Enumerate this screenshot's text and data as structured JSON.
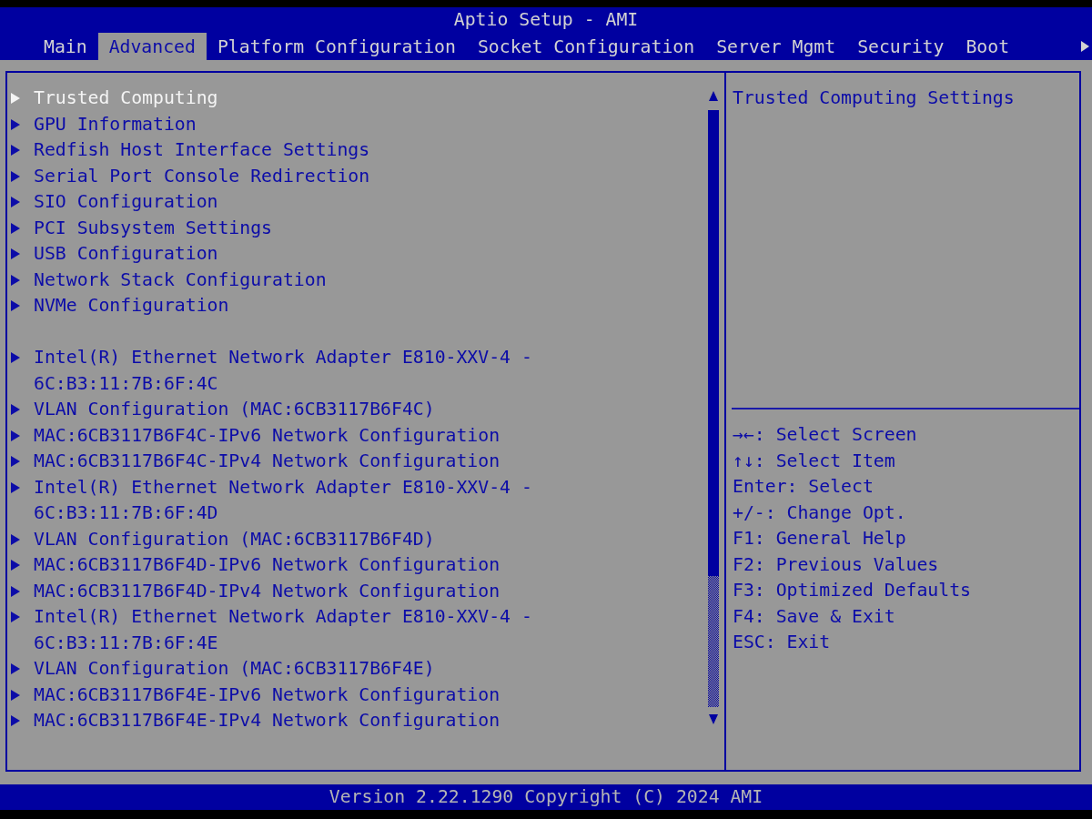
{
  "window": {
    "title": "Aptio Setup - AMI"
  },
  "tabs": [
    {
      "label": "Main",
      "selected": false
    },
    {
      "label": "Advanced",
      "selected": true
    },
    {
      "label": "Platform Configuration",
      "selected": false
    },
    {
      "label": "Socket Configuration",
      "selected": false
    },
    {
      "label": "Server Mgmt",
      "selected": false
    },
    {
      "label": "Security",
      "selected": false
    },
    {
      "label": "Boot",
      "selected": false
    }
  ],
  "menu": {
    "groups": [
      {
        "items": [
          {
            "label": "Trusted Computing",
            "selected": true
          },
          {
            "label": "GPU Information",
            "selected": false
          },
          {
            "label": "Redfish Host Interface Settings",
            "selected": false
          },
          {
            "label": "Serial Port Console Redirection",
            "selected": false
          },
          {
            "label": "SIO Configuration",
            "selected": false
          },
          {
            "label": "PCI Subsystem Settings",
            "selected": false
          },
          {
            "label": "USB Configuration",
            "selected": false
          },
          {
            "label": "Network Stack Configuration",
            "selected": false
          },
          {
            "label": "NVMe Configuration",
            "selected": false
          }
        ]
      },
      {
        "items": [
          {
            "label": "Intel(R) Ethernet Network Adapter E810-XXV-4 - 6C:B3:11:7B:6F:4C",
            "selected": false
          },
          {
            "label": "VLAN Configuration (MAC:6CB3117B6F4C)",
            "selected": false
          },
          {
            "label": "MAC:6CB3117B6F4C-IPv6 Network Configuration",
            "selected": false
          },
          {
            "label": "MAC:6CB3117B6F4C-IPv4 Network Configuration",
            "selected": false
          },
          {
            "label": "Intel(R) Ethernet Network Adapter E810-XXV-4 - 6C:B3:11:7B:6F:4D",
            "selected": false
          },
          {
            "label": "VLAN Configuration (MAC:6CB3117B6F4D)",
            "selected": false
          },
          {
            "label": "MAC:6CB3117B6F4D-IPv6 Network Configuration",
            "selected": false
          },
          {
            "label": "MAC:6CB3117B6F4D-IPv4 Network Configuration",
            "selected": false
          },
          {
            "label": "Intel(R) Ethernet Network Adapter E810-XXV-4 - 6C:B3:11:7B:6F:4E",
            "selected": false
          },
          {
            "label": "VLAN Configuration (MAC:6CB3117B6F4E)",
            "selected": false
          },
          {
            "label": "MAC:6CB3117B6F4E-IPv6 Network Configuration",
            "selected": false
          },
          {
            "label": "MAC:6CB3117B6F4E-IPv4 Network Configuration",
            "selected": false
          }
        ]
      }
    ]
  },
  "help": {
    "description": "Trusted Computing Settings",
    "keys": [
      "→←: Select Screen",
      "↑↓: Select Item",
      "Enter: Select",
      "+/-: Change Opt.",
      "F1: General Help",
      "F2: Previous Values",
      "F3: Optimized Defaults",
      "F4: Save & Exit",
      "ESC: Exit"
    ]
  },
  "status_bar": {
    "text": "Version 2.22.1290 Copyright (C) 2024 AMI"
  }
}
